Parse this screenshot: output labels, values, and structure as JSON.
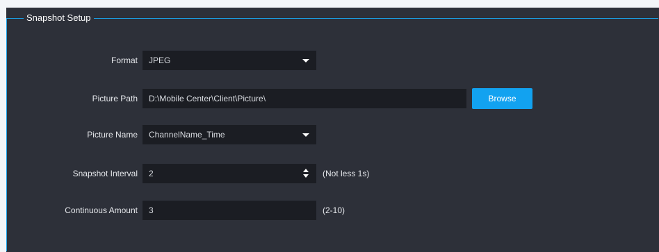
{
  "group": {
    "title": "Snapshot Setup"
  },
  "fields": {
    "format": {
      "label": "Format",
      "value": "JPEG"
    },
    "picture_path": {
      "label": "Picture Path",
      "value": "D:\\Mobile Center\\Client\\Picture\\",
      "button": "Browse"
    },
    "picture_name": {
      "label": "Picture Name",
      "value": "ChannelName_Time"
    },
    "snapshot_interval": {
      "label": "Snapshot Interval",
      "value": "2",
      "hint": "(Not less 1s)"
    },
    "continuous_amount": {
      "label": "Continuous Amount",
      "value": "3",
      "hint": "(2-10)"
    }
  },
  "colors": {
    "panel_bg": "#2d3039",
    "field_bg": "#1b1d23",
    "accent": "#12a2f0",
    "group_border": "#1aa0e6"
  },
  "icons": {
    "dropdown": "chevron-down-icon",
    "spinner": "spinner-arrows-icon"
  }
}
